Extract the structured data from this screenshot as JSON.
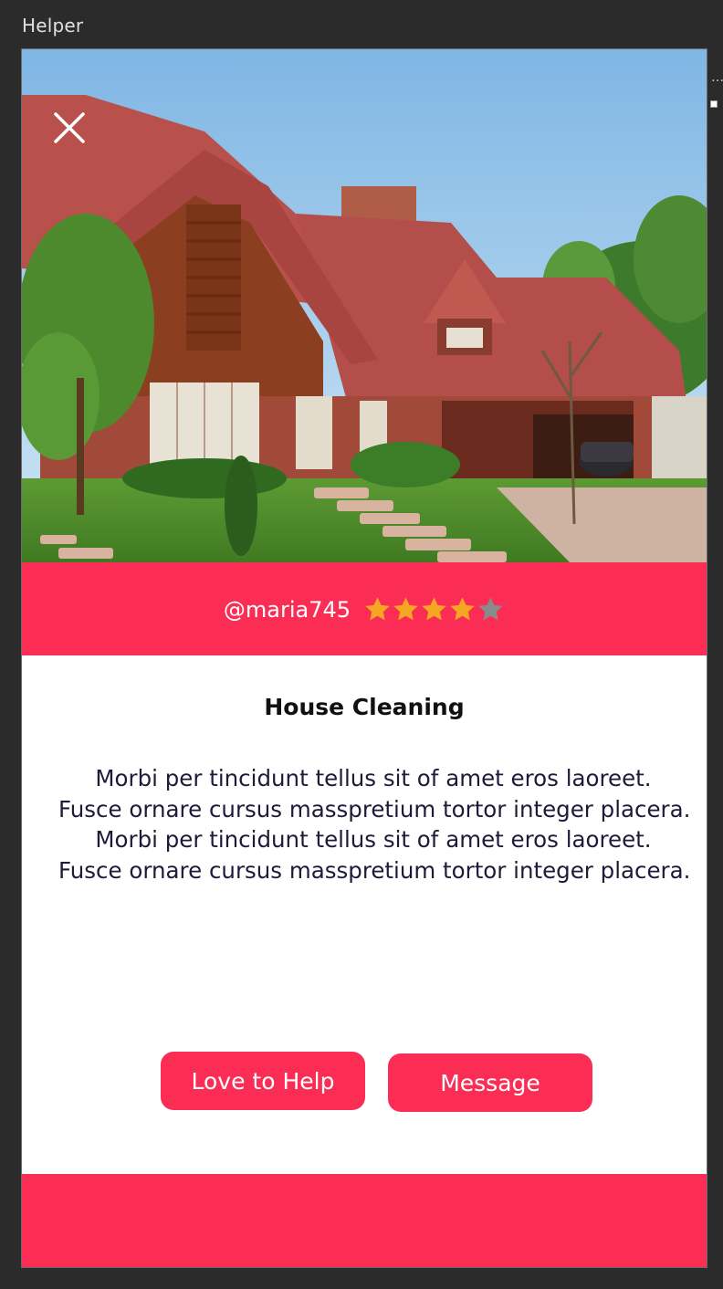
{
  "window": {
    "title": "Helper"
  },
  "hero": {
    "image": "house-photo",
    "close_icon": "close-icon"
  },
  "profile": {
    "username": "@maria745",
    "rating": 4,
    "rating_max": 5,
    "star_color_filled": "#f5a623",
    "star_color_empty": "#8a8a8a"
  },
  "content": {
    "title": "House Cleaning",
    "description_lines": [
      "Morbi per tincidunt tellus sit of amet eros laoreet.",
      "Fusce ornare cursus masspretium tortor integer placera.",
      "Morbi per tincidunt tellus sit of amet eros laoreet.",
      "Fusce ornare cursus masspretium tortor integer placera."
    ]
  },
  "actions": {
    "love_to_help_label": "Love to Help",
    "message_label": "Message"
  },
  "colors": {
    "accent": "#fb2d55",
    "background": "#ffffff",
    "chrome": "#2b2b2b"
  }
}
